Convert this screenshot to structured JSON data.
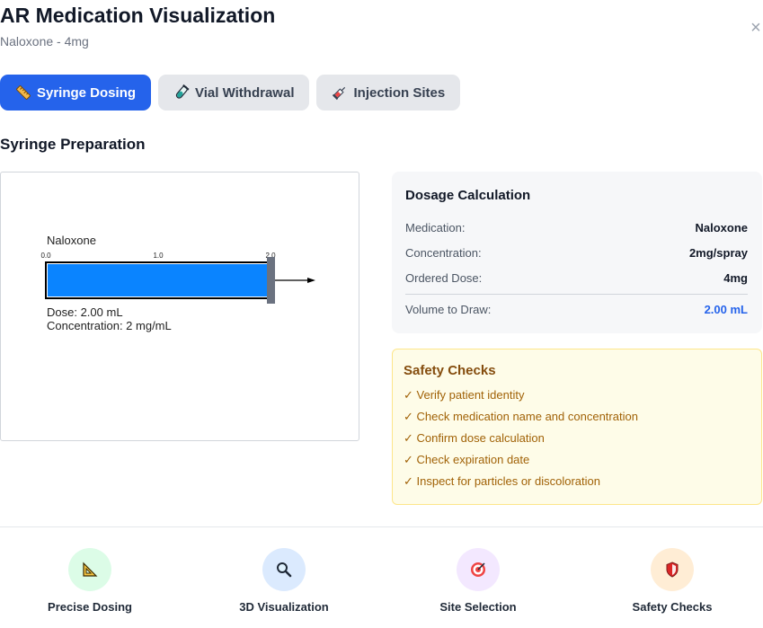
{
  "header": {
    "title": "AR Medication Visualization",
    "subtitle": "Naloxone - 4mg",
    "close_label": "×"
  },
  "tabs": [
    {
      "label": "Syringe Dosing",
      "icon": "ruler-icon",
      "active": true
    },
    {
      "label": "Vial Withdrawal",
      "icon": "test-tube-icon",
      "active": false
    },
    {
      "label": "Injection Sites",
      "icon": "syringe-icon",
      "active": false
    }
  ],
  "section": {
    "title": "Syringe Preparation"
  },
  "syringe": {
    "medication_label": "Naloxone",
    "tick_labels": [
      "0.0",
      "1.0",
      "2.0"
    ],
    "dose_text": "Dose: 2.00 mL",
    "concentration_text": "Concentration: 2 mg/mL",
    "fill_fraction": 1.0,
    "max_volume_ml": 2.0,
    "fill_color": "#0a84ff"
  },
  "dosage": {
    "title": "Dosage Calculation",
    "rows": [
      {
        "label": "Medication:",
        "value": "Naloxone"
      },
      {
        "label": "Concentration:",
        "value": "2mg/spray"
      },
      {
        "label": "Ordered Dose:",
        "value": "4mg"
      }
    ],
    "result": {
      "label": "Volume to Draw:",
      "value": "2.00 mL"
    }
  },
  "safety": {
    "title": "Safety Checks",
    "items": [
      "✓ Verify patient identity",
      "✓ Check medication name and concentration",
      "✓ Confirm dose calculation",
      "✓ Check expiration date",
      "✓ Inspect for particles or discoloration"
    ]
  },
  "features": [
    {
      "label": "Precise Dosing",
      "icon": "triangle-ruler-icon",
      "bg": "#dcfce7"
    },
    {
      "label": "3D Visualization",
      "icon": "magnifier-icon",
      "bg": "#dbeafe"
    },
    {
      "label": "Site Selection",
      "icon": "target-icon",
      "bg": "#f3e8ff"
    },
    {
      "label": "Safety Checks",
      "icon": "shield-icon",
      "bg": "#ffedd5"
    }
  ],
  "colors": {
    "accent": "#2563eb",
    "tab_inactive": "#e5e7eb",
    "safety_text": "#a16207",
    "safety_title": "#854d0e"
  }
}
